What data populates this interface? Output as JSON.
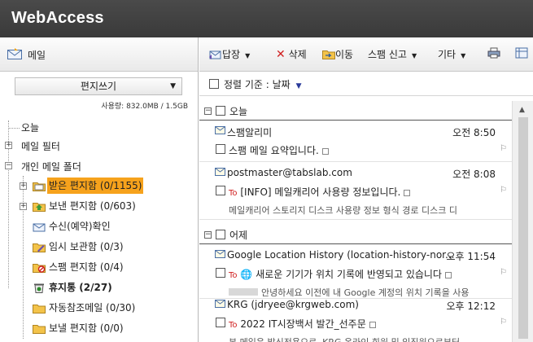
{
  "app": {
    "title": "WebAccess"
  },
  "left": {
    "header_label": "메일",
    "compose_label": "편지쓰기",
    "usage_text": "사용량: 832.0MB / 1.5GB",
    "tree": {
      "today": "오늘",
      "mail_filter": "메일 필터",
      "personal": "개인 메일 폴더",
      "inbox": "받은 편지함 (0/1155)",
      "sent": "보낸 편지함 (0/603)",
      "receipt": "수신(예약)확인",
      "drafts": "임시 보관함 (0/3)",
      "spam": "스팸 편지함 (0/4)",
      "trash": "휴지통 (2/27)",
      "autoref": "자동참조메일 (0/30)",
      "sent2": "보낼 편지함 (0/0)"
    }
  },
  "toolbar": {
    "reply": "답장",
    "delete": "삭제",
    "move": "이동",
    "spam_report": "스팸 신고",
    "other": "기타"
  },
  "sort": {
    "label": "정렬 기준 : 날짜"
  },
  "list": {
    "groups": {
      "today": "오늘",
      "yesterday": "어제"
    },
    "messages": [
      {
        "from": "스팸알리미",
        "time": "오전 8:50",
        "subject": "스팸 메일 요약입니다.",
        "preview": ""
      },
      {
        "from": "postmaster@tabslab.com",
        "time": "오전 8:08",
        "to_tag": "To",
        "subject": "[INFO] 메일캐리어 사용량 정보입니다.",
        "preview": "메일캐리어 스토리지 디스크 사용량 정보 형식 경로 디스크 디"
      },
      {
        "from": "Google Location History (location-history-nor...",
        "time": "오후 11:54",
        "to_tag": "To",
        "subject": "새로운 기기가 위치 기록에 반영되고 있습니다",
        "preview": "안녕하세요 이전에 내 Google 계정의 위치 기록을 사용"
      },
      {
        "from": "KRG (jdryee@krgweb.com)",
        "time": "오후 12:12",
        "to_tag": "To",
        "subject": "2022 IT시장백서 발간_선주문",
        "preview": "본 메일은 발신전용으로, KRG 온라인 회원 및 임직원으로부터"
      }
    ]
  },
  "colors": {
    "topbar": "#3f3f3f",
    "selected": "#f6a21c",
    "to_tag": "#d02020"
  }
}
